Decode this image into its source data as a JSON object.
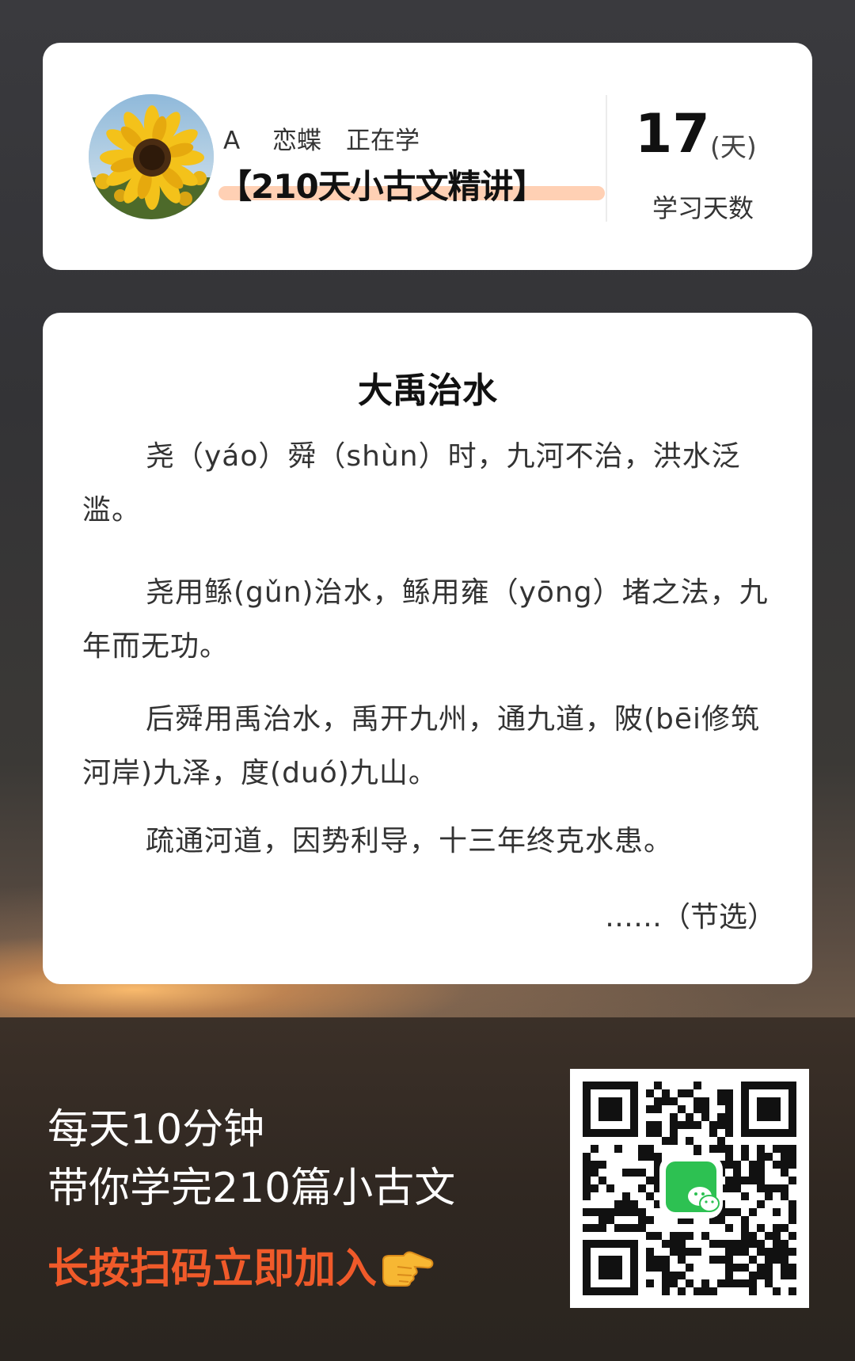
{
  "header_card": {
    "user_line": "A　 恋蝶　正在学",
    "course_title": "【210天小古文精讲】",
    "days_count": "17",
    "days_unit": "(天)",
    "days_label": "学习天数",
    "avatar_icon": "sunflower-avatar",
    "highlight_color": "#ffd0b4"
  },
  "story": {
    "title": "大禹治水",
    "paragraphs": [
      "尧（yáo）舜（shùn）时，九河不治，洪水泛滥。",
      "尧用鲧(gǔn)治水，鲧用雍（yōng）堵之法，九年而无功。",
      "后舜用禹治水，禹开九州，通九道，陂(bēi修筑河岸)九泽，度(duó)九山。",
      "疏通河道，因势利导，十三年终克水患。"
    ],
    "excerpt_note": "……（节选）"
  },
  "promo": {
    "line1": "每天10分钟",
    "line2": "带你学完210篇小古文",
    "cta": "长按扫码立即加入",
    "cta_icon": "pointing-hand-icon",
    "cta_color": "#f05a2a",
    "qr_icon": "wechat-qr-code",
    "qr_logo_color": "#2dc152"
  }
}
